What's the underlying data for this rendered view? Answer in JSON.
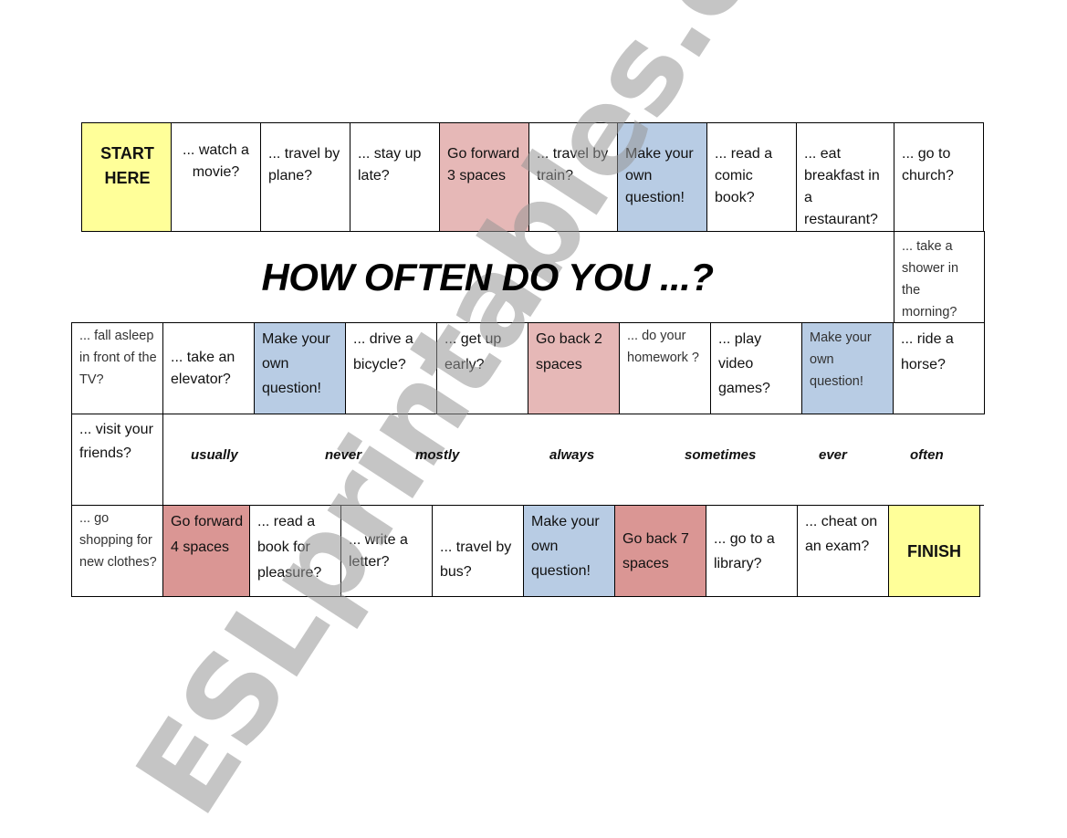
{
  "title": "HOW OFTEN DO YOU ...?",
  "colors": {
    "start_finish": "#FFFF99",
    "forward_back_light": "#E6B8B7",
    "forward_back_dark": "#DA9694",
    "own_question": "#B8CCE4"
  },
  "row1": [
    {
      "text": "START HERE",
      "type": "start"
    },
    {
      "text": "... watch a movie?",
      "type": "question"
    },
    {
      "text": "... travel by plane?",
      "type": "question"
    },
    {
      "text": "... stay up late?",
      "type": "question"
    },
    {
      "text": "Go forward 3 spaces",
      "type": "move"
    },
    {
      "text": "... travel by train?",
      "type": "question"
    },
    {
      "text": "Make your own question!",
      "type": "own"
    },
    {
      "text": "... read a comic book?",
      "type": "question"
    },
    {
      "text": "... eat breakfast in a restaurant?",
      "type": "question"
    },
    {
      "text": "... go to church?",
      "type": "question"
    }
  ],
  "row2_right": {
    "text": "... take a shower in the morning?",
    "type": "question"
  },
  "row3": [
    {
      "text": "... fall asleep in front of the TV?",
      "type": "question"
    },
    {
      "text": "... take an elevator?",
      "type": "question"
    },
    {
      "text": "Make your own question!",
      "type": "own"
    },
    {
      "text": "... drive a bicycle?",
      "type": "question"
    },
    {
      "text": "... get up early?",
      "type": "question"
    },
    {
      "text": "Go back 2 spaces",
      "type": "move"
    },
    {
      "text": "... do your homework ?",
      "type": "question"
    },
    {
      "text": "... play video games?",
      "type": "question"
    },
    {
      "text": "Make your own question!",
      "type": "own"
    },
    {
      "text": "... ride a horse?",
      "type": "question"
    }
  ],
  "row4_left": {
    "text": "... visit your friends?",
    "type": "question"
  },
  "adverbs": [
    "usually",
    "never",
    "mostly",
    "always",
    "sometimes",
    "ever",
    "often"
  ],
  "row5": [
    {
      "text": "... go shopping for new clothes?",
      "type": "question"
    },
    {
      "text": "Go forward 4 spaces",
      "type": "move"
    },
    {
      "text": "... read a book for pleasure?",
      "type": "question"
    },
    {
      "text": "... write a letter?",
      "type": "question"
    },
    {
      "text": "... travel by bus?",
      "type": "question"
    },
    {
      "text": "Make your own question!",
      "type": "own"
    },
    {
      "text": "Go back 7 spaces",
      "type": "move"
    },
    {
      "text": "... go to a library?",
      "type": "question"
    },
    {
      "text": "... cheat on an exam?",
      "type": "question"
    },
    {
      "text": "FINISH",
      "type": "finish"
    }
  ],
  "watermark": "ESLprintables.com"
}
